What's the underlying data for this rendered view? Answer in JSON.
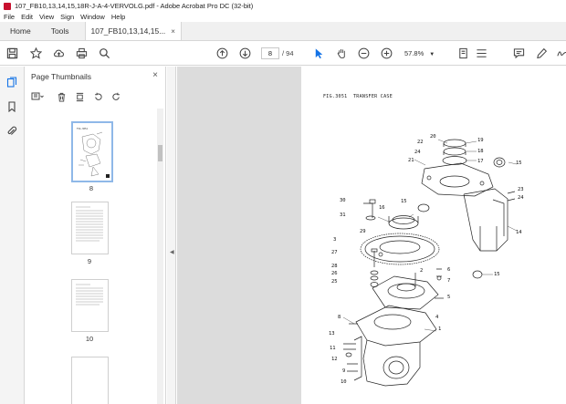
{
  "window": {
    "title": "107_FB10,13,14,15,18R-J-A-4-VERVOLG.pdf - Adobe Acrobat Pro DC (32-bit)"
  },
  "menu": [
    "File",
    "Edit",
    "View",
    "Sign",
    "Window",
    "Help"
  ],
  "tabs": {
    "home": "Home",
    "tools": "Tools",
    "doc": "107_FB10,13,14,15...",
    "doc_close": "×"
  },
  "toolbar": {
    "page_current": "8",
    "page_total": "/ 94",
    "zoom": "57.8%"
  },
  "panel": {
    "title": "Page Thumbnails",
    "close": "×",
    "thumbnails": [
      {
        "label": "8",
        "selected": true
      },
      {
        "label": "9",
        "selected": false
      },
      {
        "label": "10",
        "selected": false
      }
    ]
  },
  "document": {
    "fig_code": "FIG.3051",
    "fig_title": "TRANSFER CASE",
    "callouts": [
      "20",
      "22",
      "19",
      "18",
      "24",
      "21",
      "17",
      "15",
      "23",
      "24",
      "30",
      "15",
      "16",
      "31",
      "14",
      "29",
      "3",
      "27",
      "2",
      "6",
      "28",
      "26",
      "7",
      "25",
      "5",
      "4",
      "8",
      "1",
      "13",
      "11",
      "12",
      "9",
      "10"
    ]
  },
  "colors": {
    "accent": "#1473e6",
    "acrobat_red": "#c8102e",
    "doc_bg": "#dcdcdc"
  }
}
